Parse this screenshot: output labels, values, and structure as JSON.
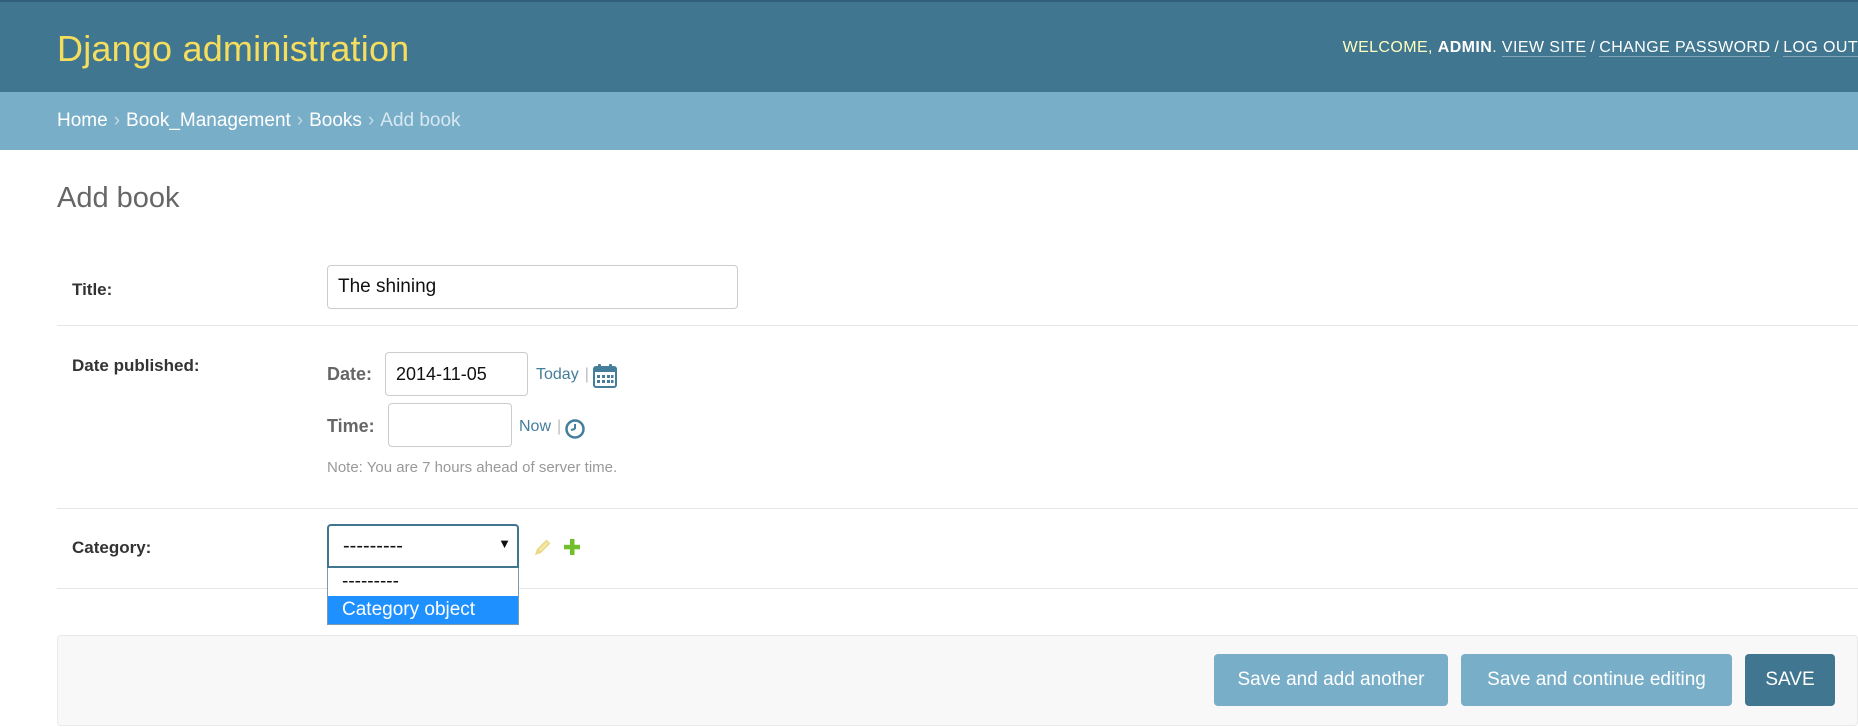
{
  "header": {
    "branding": "Django administration",
    "user_tools": {
      "welcome": "WELCOME,",
      "username": "ADMIN",
      "period": ".",
      "view_site": "VIEW SITE",
      "change_password": "CHANGE PASSWORD",
      "log_out": "LOG OUT",
      "separator": "/"
    }
  },
  "breadcrumbs": {
    "home": "Home",
    "app": "Book_Management",
    "model": "Books",
    "current": "Add book",
    "separator": "›"
  },
  "page_title": "Add book",
  "form": {
    "title": {
      "label": "Title:",
      "value": "The shining"
    },
    "date_published": {
      "label": "Date published:",
      "date_label": "Date:",
      "date_value": "2014-11-05",
      "today_link": "Today",
      "time_label": "Time:",
      "time_value": "",
      "now_link": "Now",
      "pipe": "|",
      "note": "Note: You are 7 hours ahead of server time."
    },
    "category": {
      "label": "Category:",
      "selected": "---------",
      "options": [
        "---------",
        "Category object"
      ],
      "highlighted_option": "Category object",
      "dropdown_open": true
    }
  },
  "submit_row": {
    "save_add_another": "Save and add another",
    "save_continue": "Save and continue editing",
    "save": "SAVE"
  },
  "colors": {
    "header_bg": "#417690",
    "branding": "#f5dd5d",
    "breadcrumbs_bg": "#79aec8",
    "link": "#447e9b",
    "button_secondary": "#79aec8",
    "button_primary": "#417690",
    "option_highlight": "#1e90ff"
  },
  "icons": {
    "calendar": "calendar-icon",
    "clock": "clock-icon",
    "edit": "pencil-icon",
    "add": "plus-icon",
    "dropdown": "caret-down-icon"
  }
}
